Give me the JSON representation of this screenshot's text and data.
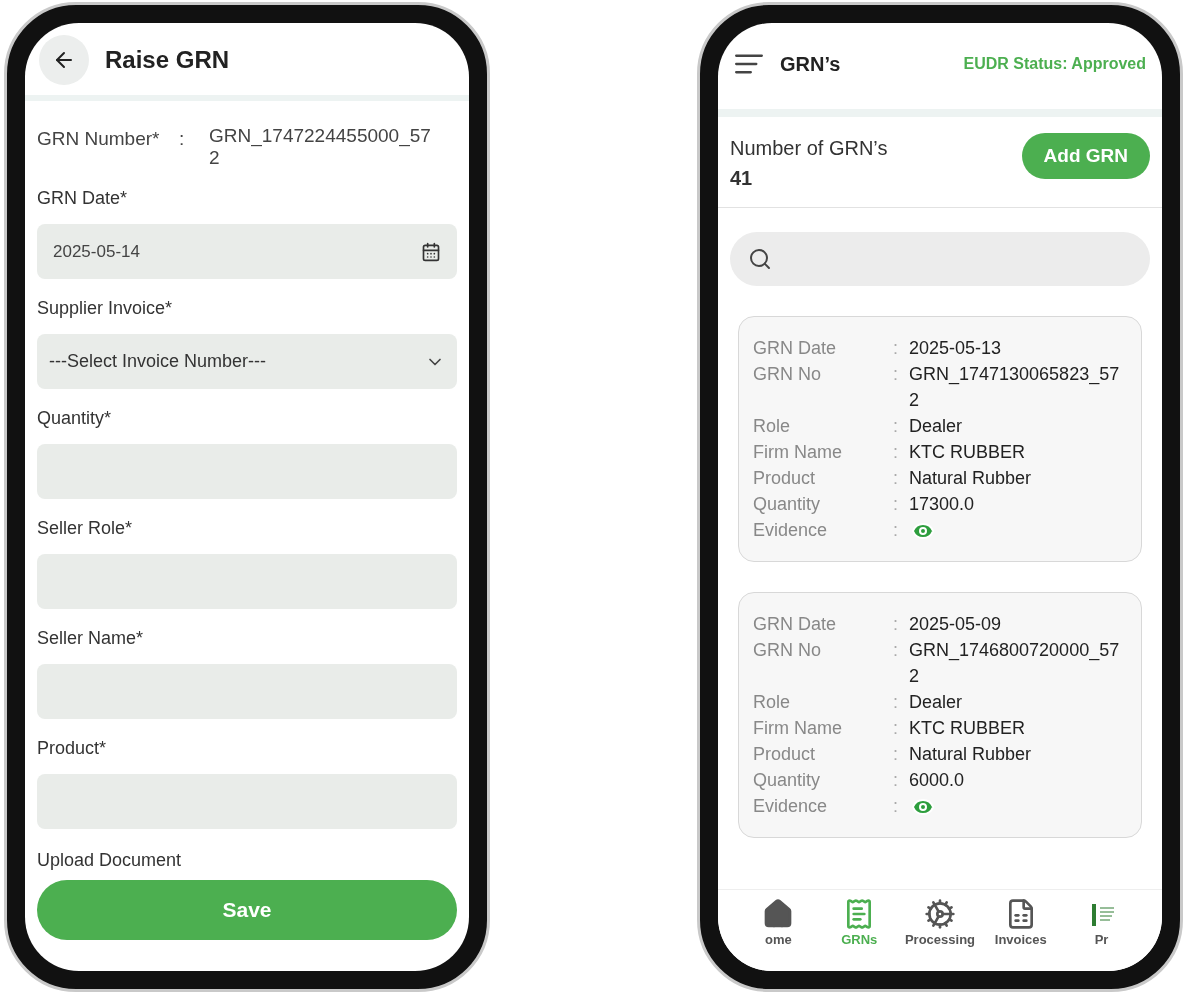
{
  "form_screen": {
    "title": "Raise GRN",
    "grn_number": {
      "label": "GRN Number*",
      "separator": ":",
      "value": "GRN_1747224455000_572"
    },
    "fields": [
      {
        "kind": "date",
        "label": "GRN Date*",
        "value": "2025-05-14"
      },
      {
        "kind": "select",
        "label": "Supplier Invoice*",
        "value": "---Select Invoice Number---"
      },
      {
        "kind": "text",
        "label": "Quantity*"
      },
      {
        "kind": "text",
        "label": "Seller Role*"
      },
      {
        "kind": "text",
        "label": "Seller Name*"
      },
      {
        "kind": "text",
        "label": "Product*"
      }
    ],
    "upload_label": "Upload Document",
    "save_button": "Save"
  },
  "list_screen": {
    "title": "GRN’s",
    "status": "EUDR Status: Approved",
    "count_label": "Number of GRN’s",
    "count": "41",
    "add_button": "Add GRN",
    "separator": ":",
    "cards": [
      {
        "rows": [
          {
            "kind": "text",
            "label": "GRN Date",
            "value": "2025-05-13"
          },
          {
            "kind": "text",
            "label": "GRN No",
            "value": "GRN_1747130065823_572"
          },
          {
            "kind": "text",
            "label": "Role",
            "value": "Dealer"
          },
          {
            "kind": "text",
            "label": "Firm Name",
            "value": "KTC RUBBER"
          },
          {
            "kind": "text",
            "label": "Product",
            "value": "Natural Rubber"
          },
          {
            "kind": "text",
            "label": "Quantity",
            "value": "17300.0"
          },
          {
            "kind": "icon",
            "label": "Evidence"
          }
        ]
      },
      {
        "rows": [
          {
            "kind": "text",
            "label": "GRN Date",
            "value": "2025-05-09"
          },
          {
            "kind": "text",
            "label": "GRN No",
            "value": "GRN_1746800720000_572"
          },
          {
            "kind": "text",
            "label": "Role",
            "value": "Dealer"
          },
          {
            "kind": "text",
            "label": "Firm Name",
            "value": "KTC RUBBER"
          },
          {
            "kind": "text",
            "label": "Product",
            "value": "Natural Rubber"
          },
          {
            "kind": "text",
            "label": "Quantity",
            "value": "6000.0"
          },
          {
            "kind": "icon",
            "label": "Evidence"
          }
        ]
      }
    ],
    "nav": [
      {
        "kind": "home",
        "label": "ome",
        "selected": false
      },
      {
        "kind": "grns",
        "label": "GRNs",
        "selected": true
      },
      {
        "kind": "processing",
        "label": "Processing",
        "selected": false
      },
      {
        "kind": "invoices",
        "label": "Invoices",
        "selected": false
      },
      {
        "kind": "profile",
        "label": "Pr",
        "selected": false
      }
    ]
  }
}
